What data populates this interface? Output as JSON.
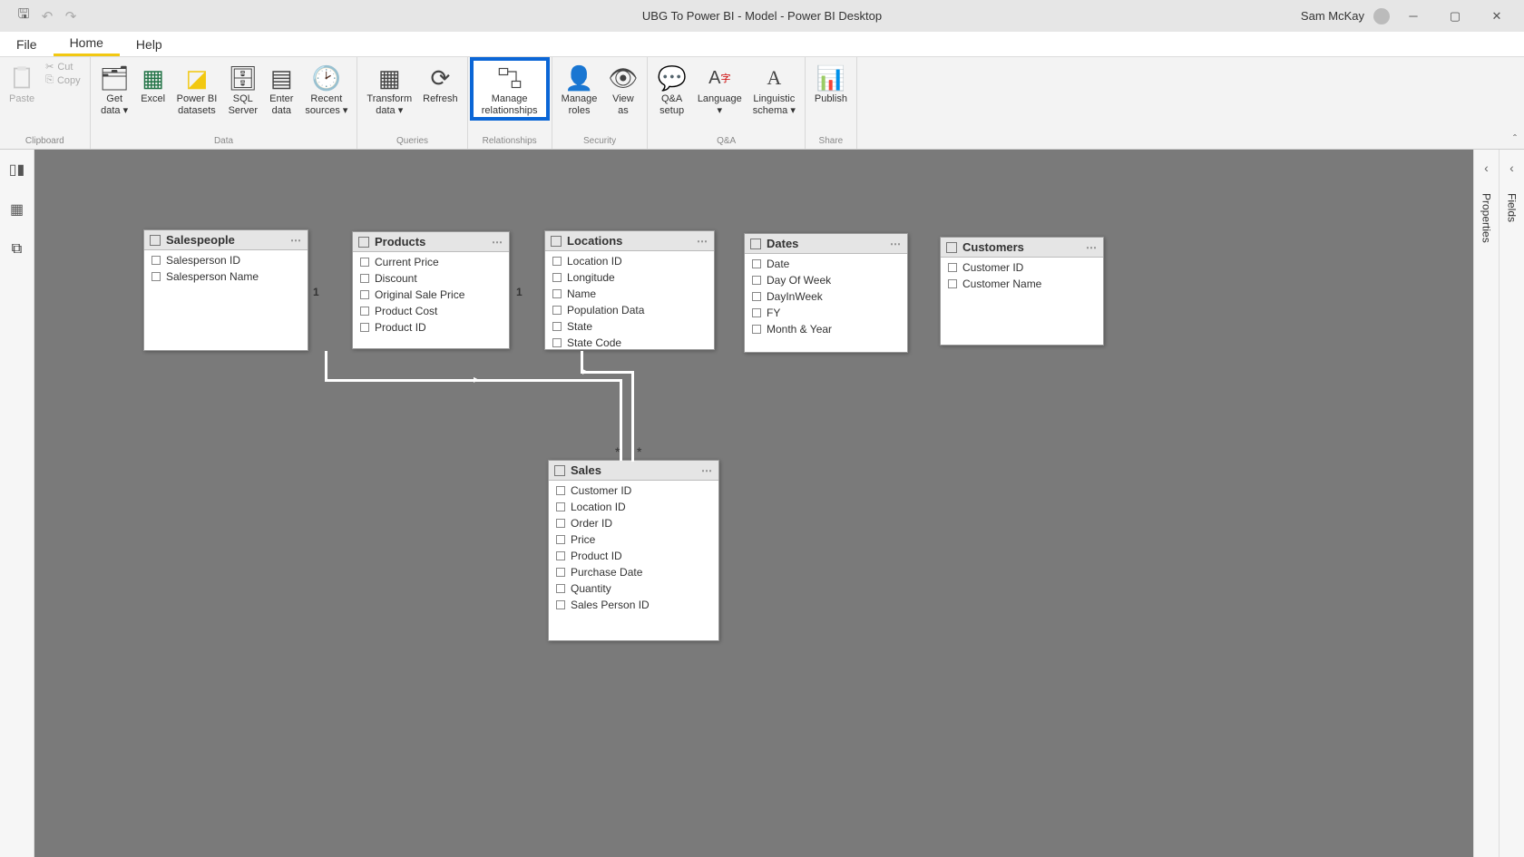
{
  "titlebar": {
    "title": "UBG To Power BI - Model - Power BI Desktop",
    "user": "Sam McKay"
  },
  "menu": {
    "file": "File",
    "home": "Home",
    "help": "Help"
  },
  "ribbon": {
    "clipboard": {
      "paste": "Paste",
      "cut": "Cut",
      "copy": "Copy",
      "label": "Clipboard"
    },
    "data": {
      "get_data": "Get\ndata ▾",
      "excel": "Excel",
      "pbi_datasets": "Power BI\ndatasets",
      "sql": "SQL\nServer",
      "enter": "Enter\ndata",
      "recent": "Recent\nsources ▾",
      "label": "Data"
    },
    "queries": {
      "transform": "Transform\ndata ▾",
      "refresh": "Refresh",
      "label": "Queries"
    },
    "relationships": {
      "manage": "Manage\nrelationships",
      "label": "Relationships"
    },
    "security": {
      "roles": "Manage\nroles",
      "view_as": "View\nas",
      "label": "Security"
    },
    "qa": {
      "setup": "Q&A\nsetup",
      "language": "Language\n▾",
      "schema": "Linguistic\nschema ▾",
      "label": "Q&A"
    },
    "share": {
      "publish": "Publish",
      "label": "Share"
    }
  },
  "right_panels": {
    "properties": "Properties",
    "fields": "Fields"
  },
  "tables": {
    "salespeople": {
      "name": "Salespeople",
      "fields": [
        "Salesperson ID",
        "Salesperson Name"
      ]
    },
    "products": {
      "name": "Products",
      "fields": [
        "Current Price",
        "Discount",
        "Original Sale Price",
        "Product Cost",
        "Product ID"
      ]
    },
    "locations": {
      "name": "Locations",
      "fields": [
        "Location ID",
        "Longitude",
        "Name",
        "Population Data",
        "State",
        "State Code"
      ]
    },
    "dates": {
      "name": "Dates",
      "fields": [
        "Date",
        "Day Of Week",
        "DayInWeek",
        "FY",
        "Month & Year"
      ]
    },
    "customers": {
      "name": "Customers",
      "fields": [
        "Customer ID",
        "Customer Name"
      ]
    },
    "sales": {
      "name": "Sales",
      "fields": [
        "Customer ID",
        "Location ID",
        "Order ID",
        "Price",
        "Product ID",
        "Purchase Date",
        "Quantity",
        "Sales Person ID"
      ]
    }
  }
}
